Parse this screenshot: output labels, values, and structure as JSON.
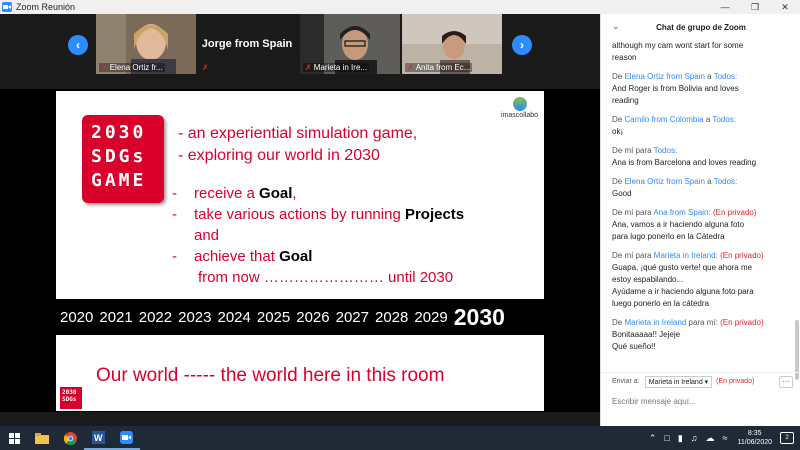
{
  "window": {
    "title": "Zoom Reunión"
  },
  "gallery": {
    "participants": [
      {
        "name": "Elena Ortiz fr..."
      },
      {
        "name": "Jorge from Spain"
      },
      {
        "name": "Marieta in Ire..."
      },
      {
        "name": "Anita from Ec..."
      }
    ]
  },
  "slide": {
    "logo_lines": [
      "2030",
      "SDGs",
      "GAME"
    ],
    "brand": "imascollabo",
    "line1": "- an experiential simulation game,",
    "line2": "- exploring our world in 2030",
    "bullets": {
      "b1_pre": "receive a ",
      "b1_bold": "Goal",
      "b1_post": ",",
      "b2_pre": "take various actions by running ",
      "b2_bold": "Projects",
      "b2_cont": "and",
      "b3_pre": "achieve that ",
      "b3_bold": "Goal",
      "b3_cont": "from now …………………… until 2030",
      "dash": "-"
    },
    "years": [
      "2020",
      "2021",
      "2022",
      "2023",
      "2024",
      "2025",
      "2026",
      "2027",
      "2028",
      "2029"
    ],
    "final_year": "2030",
    "footer": "Our world  ----- the world here in this room",
    "mini_logo": [
      "2030",
      "SDGs"
    ]
  },
  "chat": {
    "title": "Chat de grupo de Zoom",
    "messages": [
      {
        "meta_pre": "",
        "from": "",
        "meta_mid": "",
        "to": "",
        "private": "",
        "lines": [
          "although my cam wont start for some",
          "reason"
        ]
      },
      {
        "meta_pre": "De ",
        "from": "Elena Ortiz from Spain",
        "meta_mid": " a ",
        "to": "Todos:",
        "private": "",
        "lines": [
          "And Roger is from Bolivia and loves",
          "reading"
        ]
      },
      {
        "meta_pre": "De ",
        "from": "Camilo from Colombia",
        "meta_mid": " a ",
        "to": "Todos:",
        "private": "",
        "lines": [
          "ok¡"
        ]
      },
      {
        "meta_pre": "De mí para ",
        "from": "",
        "meta_mid": "",
        "to": "Todos:",
        "private": "",
        "lines": [
          "Ana is from Barcelona and loves reading"
        ]
      },
      {
        "meta_pre": "De ",
        "from": "Elena Ortiz from Spain",
        "meta_mid": " a ",
        "to": "Todos:",
        "private": "",
        "lines": [
          "Good"
        ]
      },
      {
        "meta_pre": "De mí para ",
        "from": "",
        "meta_mid": "",
        "to": "Ana from Spain:",
        "private": "(En privado)",
        "lines": [
          "Ana, vamos a ir haciendo alguna foto",
          "para lugo ponerlo en la Cátedra"
        ]
      },
      {
        "meta_pre": "De mí para ",
        "from": "",
        "meta_mid": "",
        "to": "Marieta in Ireland:",
        "private": "(En privado)",
        "lines": [
          "Guapa, ¡qué gusto verte! que ahora me",
          "estoy espabilando...",
          "Ayúdame a ir haciendo alguna foto para",
          "luego ponerlo en la cátedra"
        ]
      },
      {
        "meta_pre": "De ",
        "from": "Marieta in Ireland",
        "meta_mid": " para mí: ",
        "to": "",
        "private": "(En privado)",
        "lines": [
          "Bonitaaaaa!! Jejeje",
          "Qué sueño!!"
        ]
      }
    ],
    "send_label": "Enviar a:",
    "send_to": "Marieta in Ireland ▾",
    "send_private": "(En privado)",
    "more": "···",
    "input_placeholder": "Escribir mensaje aquí..."
  },
  "taskbar": {
    "time": "8:35",
    "date": "11/06/2020",
    "notif_count": "2"
  }
}
